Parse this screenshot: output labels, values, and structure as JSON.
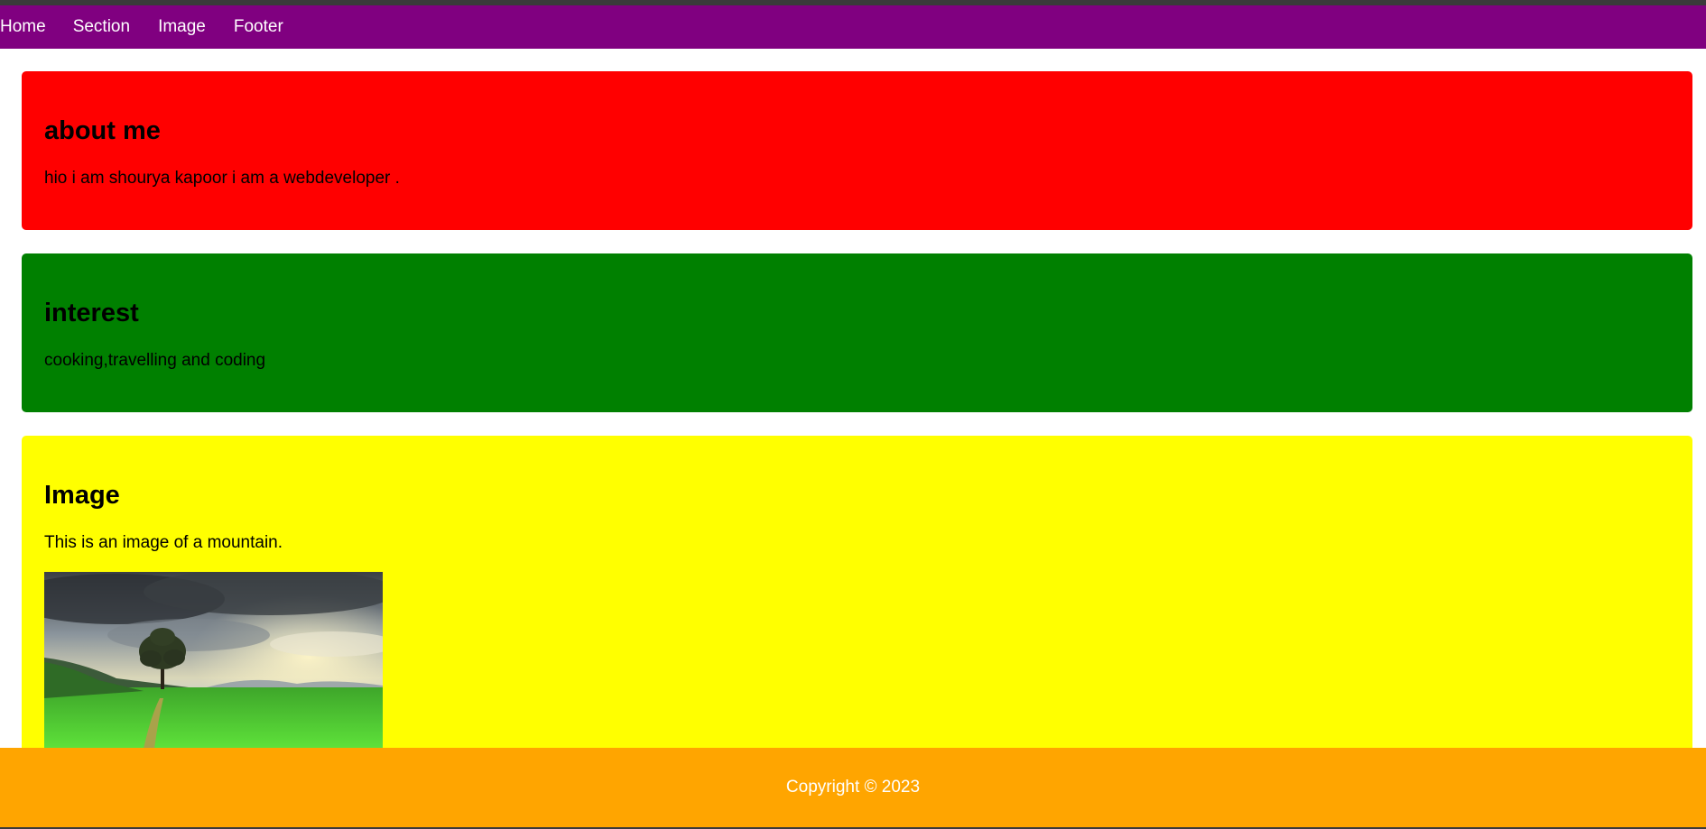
{
  "nav": {
    "items": [
      {
        "label": "Home"
      },
      {
        "label": "Section"
      },
      {
        "label": "Image"
      },
      {
        "label": "Footer"
      }
    ]
  },
  "sections": {
    "about": {
      "heading": "about me",
      "text": "hio i am shourya kapoor i am a webdeveloper ."
    },
    "interest": {
      "heading": "interest",
      "text": "cooking,travelling and coding"
    },
    "image": {
      "heading": "Image",
      "text": "This is an image of a mountain."
    }
  },
  "footer": {
    "copyright": "Copyright © 2023"
  },
  "colors": {
    "nav_bg": "#800080",
    "about_bg": "#ff0000",
    "interest_bg": "#008000",
    "image_bg": "#ffff00",
    "footer_bg": "#ffa500"
  }
}
